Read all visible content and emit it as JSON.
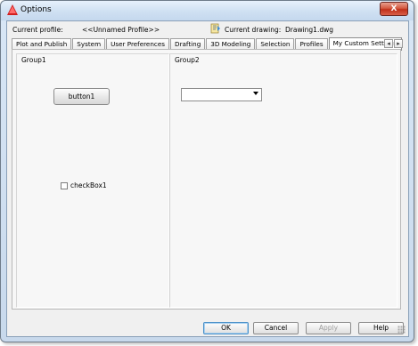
{
  "window": {
    "title": "Options",
    "close_label": "X"
  },
  "header": {
    "current_profile_label": "Current profile:",
    "current_profile_value": "<<Unnamed Profile>>",
    "current_drawing_label": "Current drawing:",
    "current_drawing_value": "Drawing1.dwg"
  },
  "tabs": [
    {
      "label": "Plot and Publish"
    },
    {
      "label": "System"
    },
    {
      "label": "User Preferences"
    },
    {
      "label": "Drafting"
    },
    {
      "label": "3D Modeling"
    },
    {
      "label": "Selection"
    },
    {
      "label": "Profiles"
    },
    {
      "label": "My Custom Settings",
      "active": true
    }
  ],
  "tab_scroll": {
    "left": "◂",
    "right": "▸"
  },
  "panel": {
    "group1": {
      "title": "Group1",
      "button_label": "button1",
      "checkbox_label": "checkBox1",
      "checkbox_checked": false
    },
    "group2": {
      "title": "Group2",
      "dropdown_value": ""
    }
  },
  "footer": {
    "ok": "OK",
    "cancel": "Cancel",
    "apply": "Apply",
    "help": "Help"
  },
  "icons": {
    "app": "autocad-icon",
    "drawing": "drawing-icon",
    "close": "close-icon",
    "dropdown": "chevron-down-icon",
    "scroll_left": "chevron-left-icon",
    "scroll_right": "chevron-right-icon"
  },
  "colors": {
    "window_frame": "#c8d9ec",
    "dialog_background": "#f0f0f0",
    "panel_background": "#f7f7f7",
    "close_button": "#c0301a",
    "ok_focus": "#4a90c8"
  }
}
